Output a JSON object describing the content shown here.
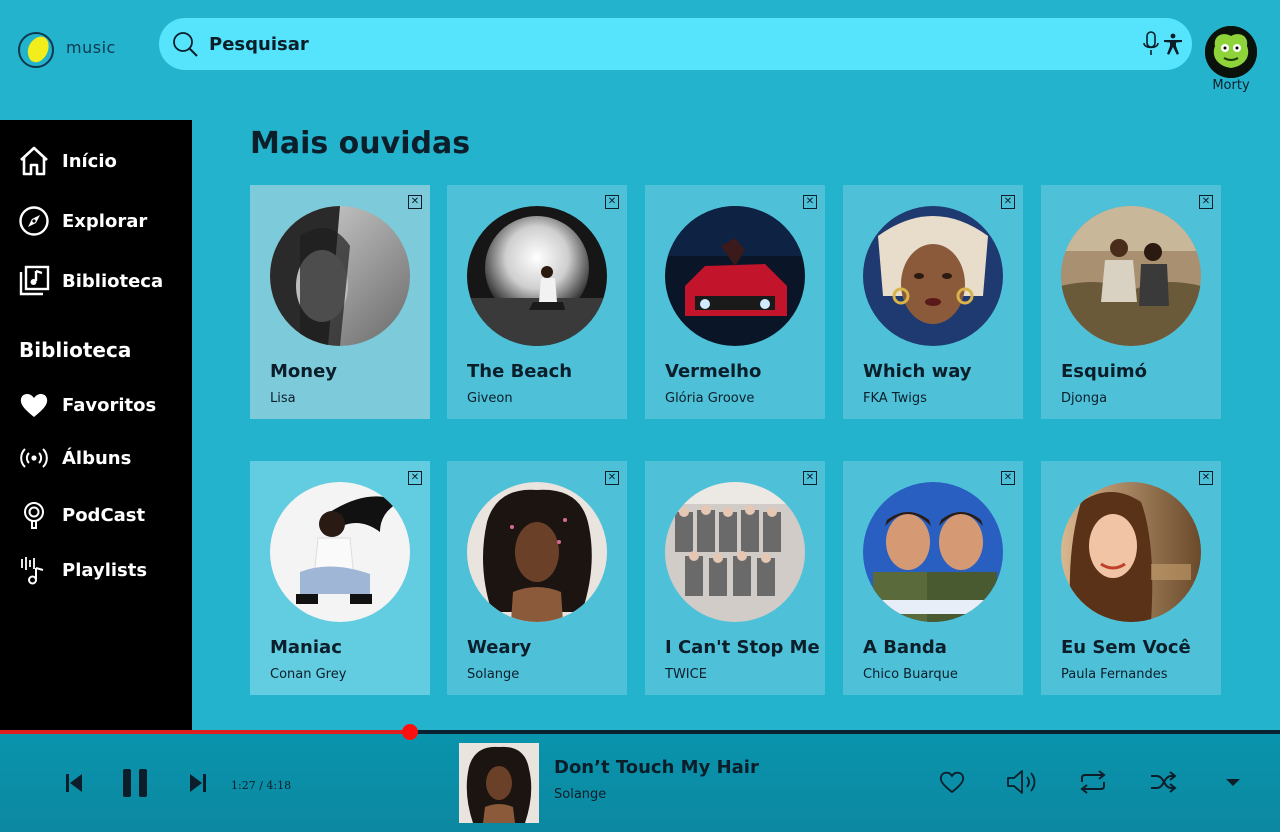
{
  "app": {
    "logo_text": "music"
  },
  "search": {
    "placeholder": "Pesquisar"
  },
  "user": {
    "name": "Morty"
  },
  "sidebar": {
    "items": [
      {
        "label": "Início",
        "icon": "home-icon"
      },
      {
        "label": "Explorar",
        "icon": "compass-icon"
      },
      {
        "label": "Biblioteca",
        "icon": "library-icon"
      }
    ],
    "library_heading": "Biblioteca",
    "library_items": [
      {
        "label": "Favoritos",
        "icon": "heart-icon"
      },
      {
        "label": "Álbuns",
        "icon": "broadcast-icon"
      },
      {
        "label": "PodCast",
        "icon": "podcast-icon"
      },
      {
        "label": "Playlists",
        "icon": "playlist-icon"
      }
    ]
  },
  "main": {
    "section_title": "Mais ouvidas",
    "close_glyph": "✕",
    "cards": [
      {
        "title": "Money",
        "artist": "Lisa"
      },
      {
        "title": "The Beach",
        "artist": "Giveon"
      },
      {
        "title": "Vermelho",
        "artist": "Glória Groove"
      },
      {
        "title": "Which way",
        "artist": "FKA Twigs"
      },
      {
        "title": "Esquimó",
        "artist": "Djonga"
      },
      {
        "title": "Maniac",
        "artist": "Conan Grey"
      },
      {
        "title": "Weary",
        "artist": "Solange"
      },
      {
        "title": "I Can't Stop Me",
        "artist": "TWICE"
      },
      {
        "title": "A Banda",
        "artist": "Chico Buarque"
      },
      {
        "title": "Eu Sem Você",
        "artist": "Paula Fernandes"
      }
    ]
  },
  "player": {
    "time": "1:27 / 4:18",
    "progress": 0.32,
    "now_playing": {
      "title": "Don’t Touch My Hair",
      "artist": "Solange"
    },
    "colors": {
      "progress": "#e01e1e",
      "knob": "#ff1010"
    }
  }
}
